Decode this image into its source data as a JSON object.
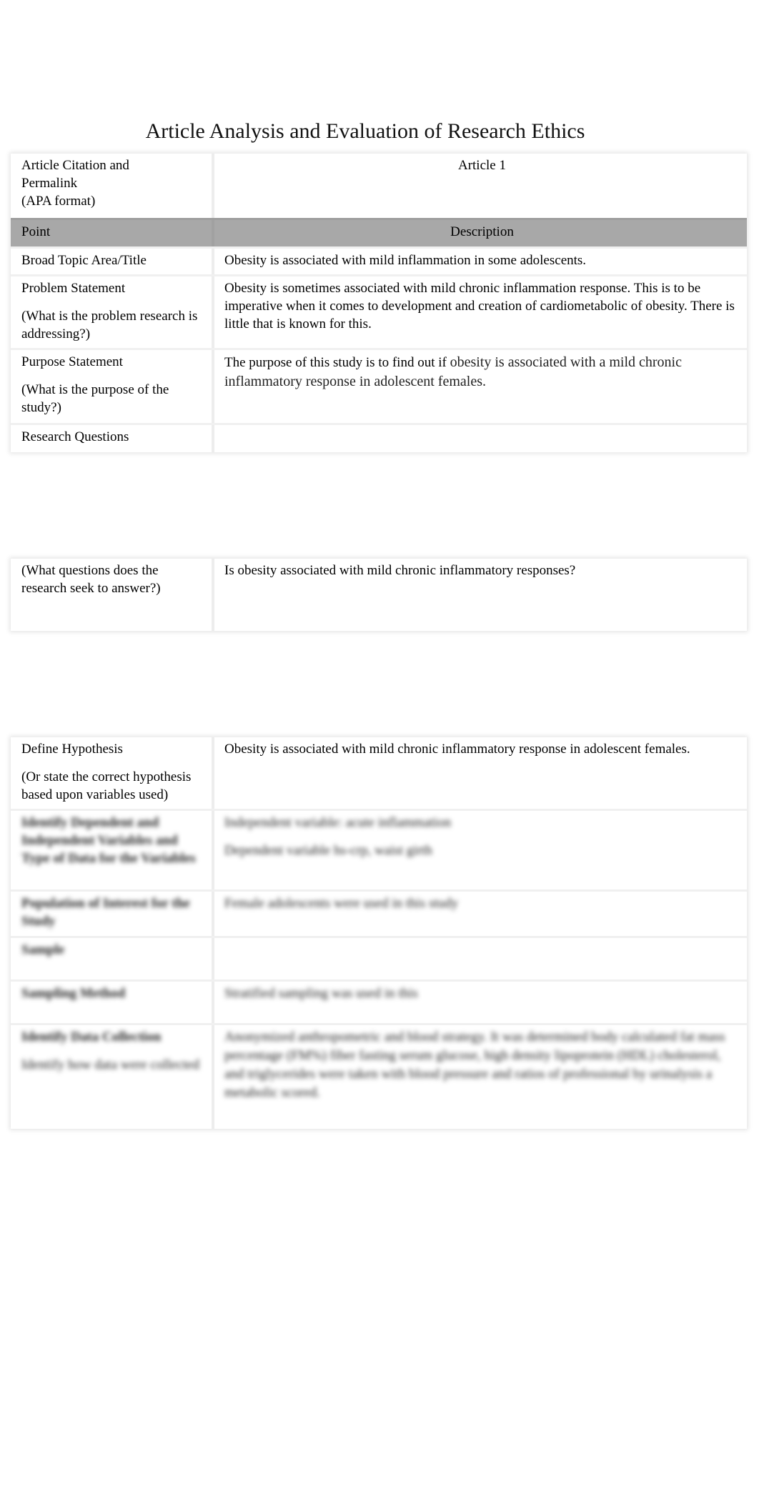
{
  "document": {
    "title": "Article Analysis and Evaluation of Research Ethics",
    "citation_row": {
      "label": "Article Citation and Permalink",
      "sublabel": "(APA format)",
      "value": "Article 1"
    },
    "header": {
      "point": "Point",
      "description": "Description"
    },
    "rows": {
      "topic": {
        "label": "Broad Topic Area/Title",
        "value": "Obesity is associated with mild inflammation in some adolescents."
      },
      "problem": {
        "label": "Problem Statement",
        "hint": "(What is the problem research is addressing?)",
        "value": "Obesity is sometimes associated with mild chronic inflammation response. This is to be imperative when it comes to development and creation of cardiometabolic of obesity. There is little that is known for this."
      },
      "purpose": {
        "label": "Purpose Statement",
        "hint": "(What is the purpose of the study?)",
        "value_lead": "The purpose of this study is to find out if ",
        "value_tail": "obesity is associated with a mild chronic inflammatory response in adolescent females."
      },
      "research_questions": {
        "label": "Research Questions",
        "hint": "(What questions does the research seek to answer?)",
        "value": "Is obesity associated with mild chronic inflammatory responses?"
      },
      "hypothesis": {
        "label": "Define Hypothesis",
        "hint": "(Or state the correct hypothesis based upon variables used)",
        "value": "Obesity is associated with mild chronic inflammatory response in adolescent females."
      },
      "variables": {
        "label": "Identify Dependent and Independent Variables and Type of Data for the Variables",
        "value_1": "Independent variable: acute inflammation",
        "value_2": "Dependent variable hs-crp, waist girth"
      },
      "population": {
        "label": "Population of Interest for the Study",
        "value": "Female adolescents were used in this study"
      },
      "sample": {
        "label": "Sample",
        "value": ""
      },
      "sampling_method": {
        "label": "Sampling Method",
        "value": "Stratified sampling was used in this"
      },
      "data_collection": {
        "label": "Identify Data Collection",
        "hint": "Identify how data were collected",
        "value": "Anonymized anthropometric and blood strategy. It was determined body calculated fat mass percentage (FM%) fiber fasting serum glucose, high density lipoprotein (HDL) cholesterol, and triglycerides were taken with blood pressure and ratios of professional by urinalysis a metabolic scored."
      }
    }
  }
}
